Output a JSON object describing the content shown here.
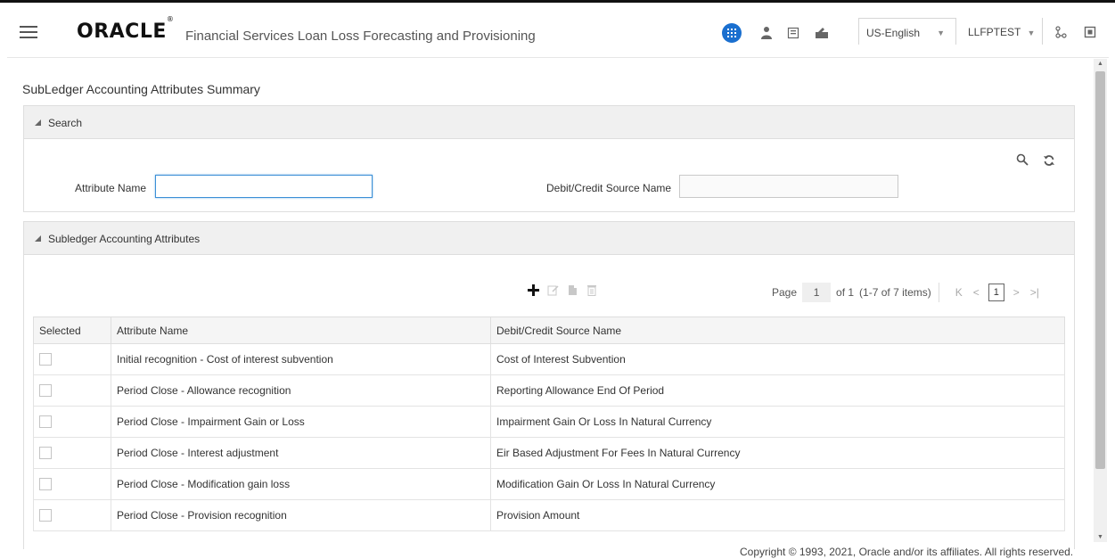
{
  "header": {
    "logo": "ORACLE",
    "logo_mark": "®",
    "app_title": "Financial Services Loan Loss Forecasting and Provisioning",
    "language": "US-English",
    "user": "LLFPTEST"
  },
  "page": {
    "title": "SubLedger Accounting Attributes Summary"
  },
  "search": {
    "section_label": "Search",
    "attribute_name_label": "Attribute Name",
    "attribute_name_value": "",
    "debit_credit_label": "Debit/Credit Source Name",
    "debit_credit_value": ""
  },
  "attributes": {
    "section_label": "Subledger Accounting Attributes",
    "pager": {
      "page_label": "Page",
      "page_value": "1",
      "of_label": "of 1",
      "items_label": "(1-7 of 7 items)",
      "current_page": "1"
    },
    "columns": [
      "Selected",
      "Attribute Name",
      "Debit/Credit Source Name"
    ],
    "rows": [
      {
        "attribute": "Initial recognition - Cost of interest subvention",
        "source": "Cost of Interest Subvention"
      },
      {
        "attribute": "Period Close - Allowance recognition",
        "source": "Reporting Allowance End Of Period"
      },
      {
        "attribute": "Period Close - Impairment Gain or Loss",
        "source": "Impairment Gain Or Loss In Natural Currency"
      },
      {
        "attribute": "Period Close - Interest adjustment",
        "source": "Eir Based Adjustment For Fees In Natural Currency"
      },
      {
        "attribute": "Period Close - Modification gain loss",
        "source": "Modification Gain Or Loss In Natural Currency"
      },
      {
        "attribute": "Period Close - Provision recognition",
        "source": "Provision Amount"
      }
    ]
  },
  "footer": {
    "copyright": "Copyright © 1993, 2021, Oracle and/or its affiliates. All rights reserved."
  },
  "icons": {
    "menu": "hamburger-menu-icon",
    "apps": "apps-grid-icon",
    "user": "user-icon",
    "book": "book-icon",
    "tools": "tools-icon",
    "sitemap": "sitemap-icon",
    "logout": "logout-icon",
    "search": "search-icon",
    "refresh": "refresh-icon",
    "add": "add-icon",
    "edit": "edit-icon",
    "copy": "copy-icon",
    "delete": "delete-icon"
  },
  "colors": {
    "accent": "#1a6fcf",
    "section_header": "#f0f0f0",
    "focus_border": "#3b8fd6"
  }
}
